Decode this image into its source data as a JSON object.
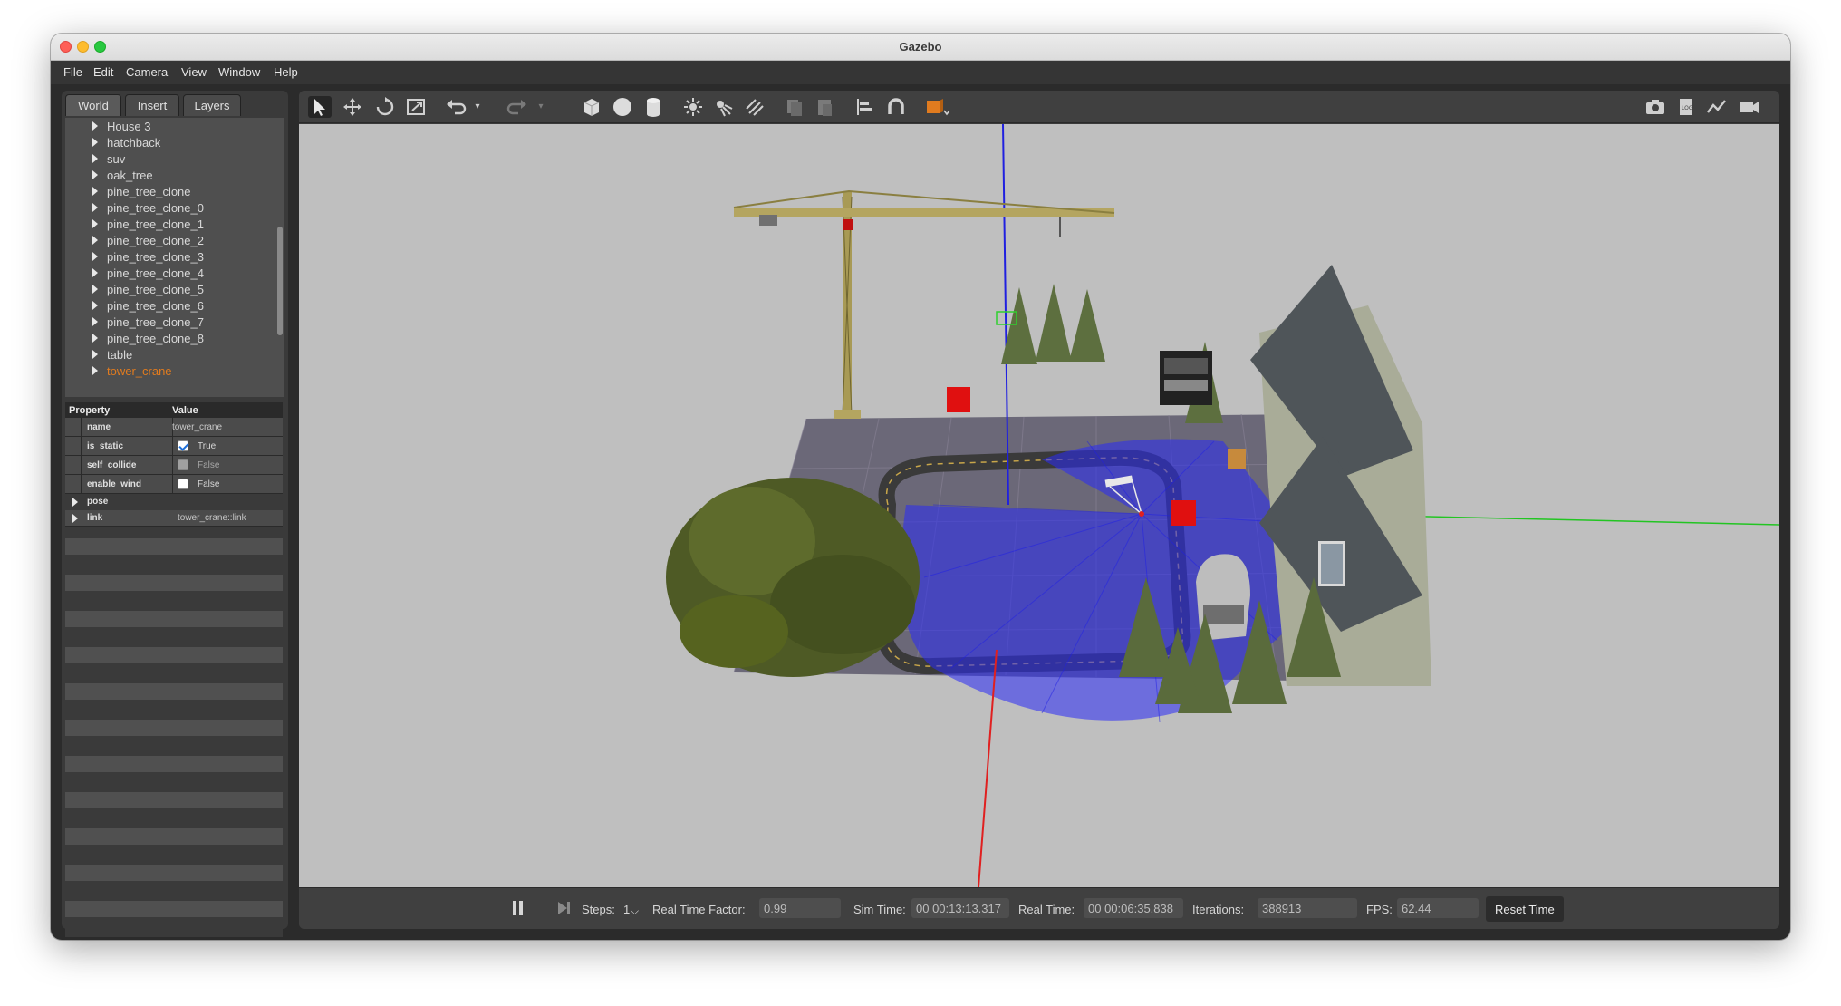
{
  "window": {
    "title": "Gazebo"
  },
  "menu": [
    "File",
    "Edit",
    "Camera",
    "View",
    "Window",
    "Help"
  ],
  "left_tabs": [
    "World",
    "Insert",
    "Layers"
  ],
  "tree_items": [
    "House 3",
    "hatchback",
    "suv",
    "oak_tree",
    "pine_tree_clone",
    "pine_tree_clone_0",
    "pine_tree_clone_1",
    "pine_tree_clone_2",
    "pine_tree_clone_3",
    "pine_tree_clone_4",
    "pine_tree_clone_5",
    "pine_tree_clone_6",
    "pine_tree_clone_7",
    "pine_tree_clone_8",
    "table",
    "tower_crane"
  ],
  "selected_item": "tower_crane",
  "properties": {
    "header_property": "Property",
    "header_value": "Value",
    "rows": [
      {
        "key": "name",
        "value": "tower_crane"
      },
      {
        "key": "is_static",
        "value": "True",
        "checked": true
      },
      {
        "key": "self_collide",
        "value": "False",
        "checked": false
      },
      {
        "key": "enable_wind",
        "value": "False",
        "checked": false
      },
      {
        "key": "pose",
        "value": ""
      },
      {
        "key": "link",
        "value": "tower_crane::link"
      }
    ]
  },
  "toolbar": {
    "tools": [
      "select-mode",
      "translate-mode",
      "rotate-mode",
      "scale-mode",
      "undo",
      "redo",
      "box",
      "sphere",
      "cylinder",
      "point-light",
      "spot-light",
      "directional-light",
      "copy",
      "paste",
      "align",
      "snap",
      "view-angle"
    ],
    "right_tools": [
      "screenshot",
      "log",
      "plot",
      "record"
    ]
  },
  "status": {
    "steps_label": "Steps:",
    "steps_value": "1",
    "rtf_label": "Real Time Factor:",
    "rtf_value": "0.99",
    "sim_time_label": "Sim Time:",
    "sim_time_value": "00 00:13:13.317",
    "real_time_label": "Real Time:",
    "real_time_value": "00 00:06:35.838",
    "iterations_label": "Iterations:",
    "iterations_value": "388913",
    "fps_label": "FPS:",
    "fps_value": "62.44",
    "reset_label": "Reset Time"
  },
  "colors": {
    "accent_selected": "#e07b1f",
    "laser": "#1a1af0",
    "ground": "#6b6878"
  }
}
